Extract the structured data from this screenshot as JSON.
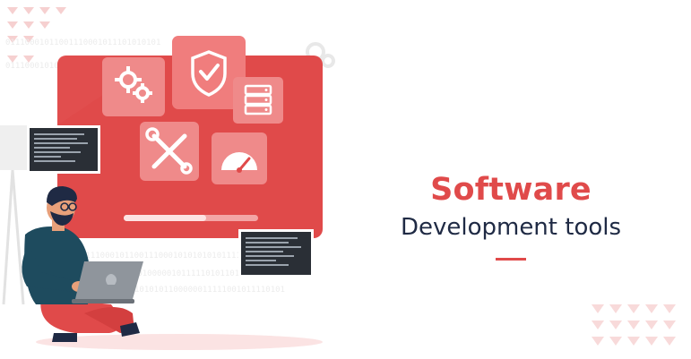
{
  "heading": {
    "title": "Software",
    "subtitle": "Development tools"
  },
  "colors": {
    "accent": "#e04a4a",
    "accent_light": "#ef8a8a",
    "accent_pale": "#fbe3e3",
    "navy": "#1f2a44",
    "dark_panel": "#2a2f36"
  },
  "binary_strings": {
    "line_a": "01110001011001110001011101010101",
    "line_b": "0111000101011",
    "line_c": "01110001011001110001010101010111110101001101",
    "line_d": "0110010101000001011111010110101",
    "line_e": "1010101100000011111001011110101"
  },
  "icons": [
    "gears-icon",
    "shield-check-icon",
    "server-icon",
    "wrench-screwdriver-icon",
    "speedometer-icon",
    "code-window-icon",
    "laptop-icon",
    "developer-figure"
  ]
}
